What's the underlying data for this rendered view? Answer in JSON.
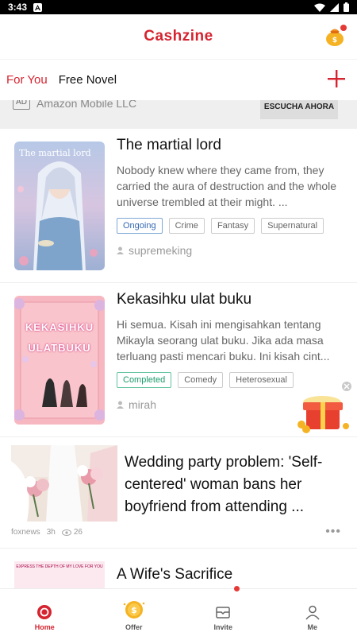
{
  "status_bar": {
    "time": "3:43"
  },
  "header": {
    "title": "Cashzine"
  },
  "tabs": [
    {
      "label": "For You",
      "active": true
    },
    {
      "label": "Free Novel",
      "active": false
    }
  ],
  "ad": {
    "badge": "AD",
    "advertiser": "Amazon Mobile LLC",
    "cta": "ESCUCHA AHORA"
  },
  "novels": [
    {
      "title": "The martial lord",
      "cover_text": "The martial lord",
      "description": "Nobody knew where they came from, they carried the aura of destruction and the whole universe trembled at their might.  ...",
      "status": "Ongoing",
      "tags": [
        "Crime",
        "Fantasy",
        "Supernatural"
      ],
      "author": "supremeking"
    },
    {
      "title": "Kekasihku ulat buku",
      "cover_text_1": "KEKASIHKU",
      "cover_text_2": "ULATBUKU",
      "description": "Hi semua. Kisah ini mengisahkan tentang Mikayla seorang ulat buku. Jika ada masa terluang pasti mencari buku. Ini kisah cint...",
      "status": "Completed",
      "tags": [
        "Comedy",
        "Heterosexual"
      ],
      "author": "mirah"
    }
  ],
  "news": {
    "title": "Wedding party problem: 'Self-centered' woman bans her boyfriend from attending ...",
    "source": "foxnews",
    "age": "3h",
    "views": "26"
  },
  "partial": {
    "title": "A Wife's Sacrifice",
    "cover_text": "EXPRESS THE DEPTH OF MY LOVE FOR YOU"
  },
  "bottom_nav": [
    {
      "label": "Home",
      "icon": "home-icon",
      "active": true
    },
    {
      "label": "Offer",
      "icon": "coin-icon",
      "active": false
    },
    {
      "label": "Invite",
      "icon": "mail-icon",
      "active": false
    },
    {
      "label": "Me",
      "icon": "person-icon",
      "active": false
    }
  ],
  "colors": {
    "brand": "#d5232f",
    "ongoing": "#3367b3",
    "completed": "#1b9b6a"
  }
}
